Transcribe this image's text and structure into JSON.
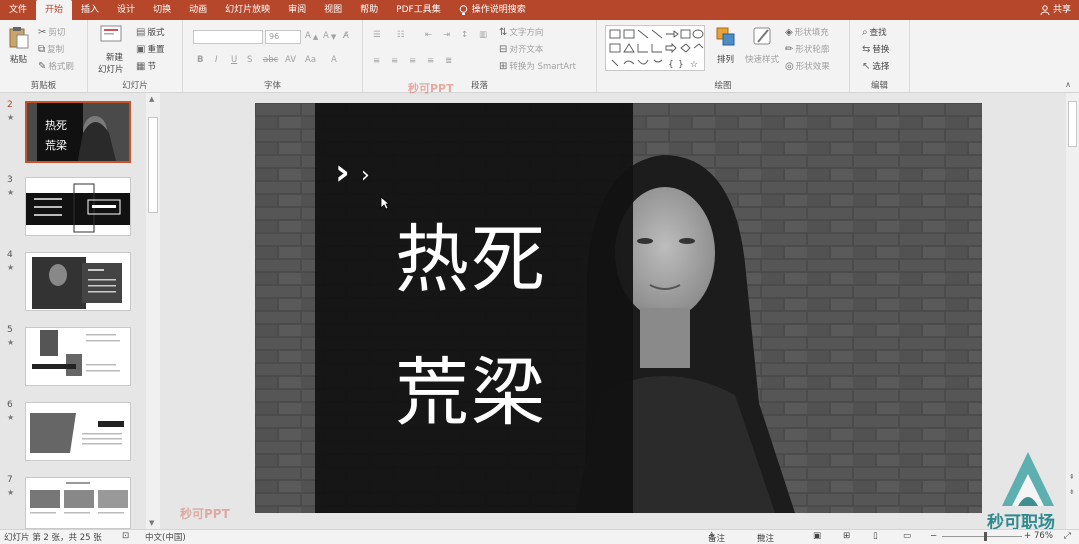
{
  "tabs": [
    "文件",
    "开始",
    "插入",
    "设计",
    "切换",
    "动画",
    "幻灯片放映",
    "审阅",
    "视图",
    "帮助",
    "PDF工具集",
    "操作说明搜索"
  ],
  "active_tab": "开始",
  "share_label": "共享",
  "ribbon": {
    "clipboard": {
      "label": "剪贴板",
      "paste": "粘贴",
      "cut": "剪切",
      "copy": "复制",
      "format_painter": "格式刷"
    },
    "slides": {
      "label": "幻灯片",
      "new_slide": "新建",
      "new_slide2": "幻灯片",
      "layout": "版式",
      "reset": "重置",
      "section": "节"
    },
    "font": {
      "label": "字体",
      "size": "96"
    },
    "paragraph": {
      "label": "段落",
      "text_direction": "文字方向",
      "align_text": "对齐文本",
      "smartart": "转换为 SmartArt"
    },
    "drawing": {
      "label": "绘图",
      "arrange": "排列",
      "quick_styles": "快速样式",
      "shape_fill": "形状填充",
      "shape_outline": "形状轮廓",
      "shape_effects": "形状效果"
    },
    "editing": {
      "label": "编辑",
      "find": "查找",
      "replace": "替换",
      "select": "选择"
    }
  },
  "watermark": "秒可PPT",
  "thumbnails": [
    {
      "num": "2",
      "star": "★"
    },
    {
      "num": "3",
      "star": "★"
    },
    {
      "num": "4",
      "star": "★"
    },
    {
      "num": "5",
      "star": "★"
    },
    {
      "num": "6",
      "star": "★"
    },
    {
      "num": "7",
      "star": "★"
    }
  ],
  "slide": {
    "title_line1": "热死",
    "title_line2": "荒梁",
    "thumb_title1": "热死",
    "thumb_title2": "荒梁"
  },
  "status": {
    "slide_info": "幻灯片 第 2 张，共 25 张",
    "language": "中文(中国)",
    "notes": "备注",
    "comments": "批注",
    "zoom": "76%"
  },
  "logo_text": "秒可职场",
  "colors": {
    "accent": "#b7472a",
    "logo": "#2f8a8f"
  }
}
